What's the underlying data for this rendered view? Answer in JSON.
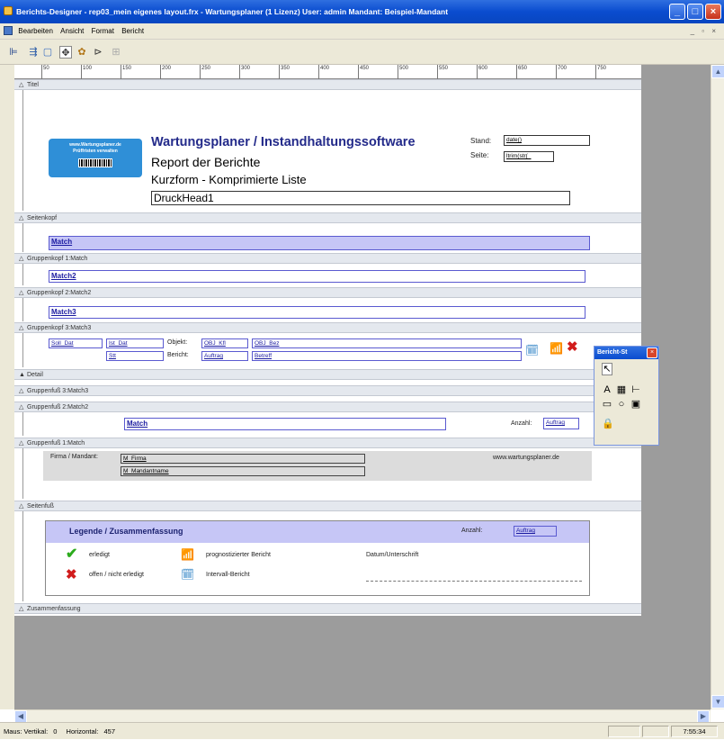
{
  "window": {
    "title": "Berichts-Designer - rep03_mein eigenes layout.frx - Wartungsplaner  (1 Lizenz)   User: admin   Mandant: Beispiel-Mandant"
  },
  "menu": {
    "items": [
      "Bearbeiten",
      "Ansicht",
      "Format",
      "Bericht"
    ]
  },
  "ruler": {
    "ticks": [
      "50",
      "100",
      "150",
      "200",
      "250",
      "300",
      "350",
      "400",
      "450",
      "500",
      "550",
      "600",
      "650",
      "700",
      "750"
    ]
  },
  "bands": {
    "titel": "Titel",
    "seitenkopf": "Seitenkopf",
    "gruppenkopf1": "Gruppenkopf 1:Match",
    "gruppenkopf2": "Gruppenkopf 2:Match2",
    "gruppenkopf3": "Gruppenkopf 3:Match3",
    "detail": "Detail",
    "gruppenfuss3": "Gruppenfuß 3:Match3",
    "gruppenfuss2": "Gruppenfuß 2:Match2",
    "gruppenfuss1": "Gruppenfuß 1:Match",
    "seitenfuss": "Seitenfuß",
    "zusammenfassung": "Zusammenfassung"
  },
  "title_band": {
    "logo_line1": "www.Wartungsplaner.de",
    "logo_line2": "Prüffristen verwalten",
    "heading": "Wartungsplaner / Instandhaltungssoftware",
    "line2": "Report der Berichte",
    "line3": "Kurzform - Komprimierte Liste",
    "druckhead": "DruckHead1",
    "stand_label": "Stand:",
    "stand_value": "date()",
    "seite_label": "Seite:",
    "seite_value": "ltrim(str(_"
  },
  "fields": {
    "match": "Match",
    "match2": "Match2",
    "match3": "Match3",
    "soll_dat": "Soll_Dat",
    "ist_dat": "Ist_Dat",
    "stt": "Stt",
    "objekt_label": "Objekt:",
    "obj_kfl": "OBJ_Kfl",
    "obj_bez": "OBJ_Bez",
    "bericht_label": "Bericht:",
    "auftrag": "Auftrag",
    "betreff": "Betreff",
    "match_footer": "Match",
    "anzahl_label": "Anzahl:",
    "anzahl_value": "Auftrag",
    "firma_label": "Firma / Mandant:",
    "m_firma": "M_Firma",
    "m_mandantname": "M_Mandantname",
    "website": "www.wartungsplaner.de"
  },
  "legend": {
    "title": "Legende / Zusammenfassung",
    "anzahl_label": "Anzahl:",
    "anzahl_value": "Auftrag",
    "erledigt": "erledigt",
    "offen": "offen / nicht erledigt",
    "prognostiziert": "prognostizierter Bericht",
    "intervall": "Intervall-Bericht",
    "datum": "Datum/Unterschrift"
  },
  "toolbox": {
    "title": "Bericht-St"
  },
  "status": {
    "maus": "Maus: Vertikal:",
    "vertikal": "0",
    "horizontal_label": "Horizontal:",
    "horizontal": "457",
    "time": "7:55:34"
  }
}
